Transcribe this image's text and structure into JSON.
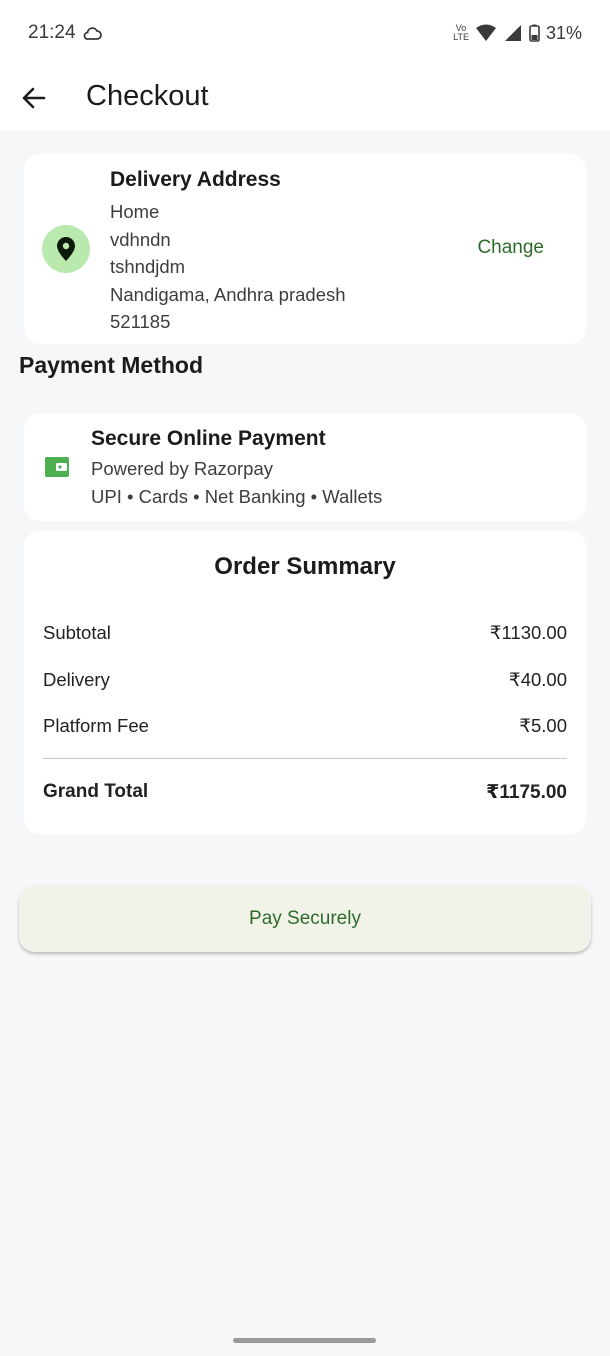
{
  "status_bar": {
    "time": "21:24",
    "battery": "31%",
    "network": "LTE"
  },
  "header": {
    "title": "Checkout"
  },
  "address": {
    "title": "Delivery Address",
    "lines": [
      "Home",
      "vdhndn",
      "tshndjdm",
      "Nandigama, Andhra pradesh",
      "521185"
    ],
    "change_label": "Change"
  },
  "payment": {
    "section_title": "Payment Method",
    "title": "Secure Online Payment",
    "subtitle": "Powered by Razorpay",
    "methods": "UPI • Cards • Net Banking • Wallets"
  },
  "summary": {
    "title": "Order Summary",
    "subtotal_label": "Subtotal",
    "subtotal_value": "₹1130.00",
    "delivery_label": "Delivery",
    "delivery_value": "₹40.00",
    "fee_label": "Platform Fee",
    "fee_value": "₹5.00",
    "total_label": "Grand Total",
    "total_value": "₹1175.00"
  },
  "pay_button_label": "Pay Securely",
  "colors": {
    "accent_green": "#2e6b2a",
    "pin_bg": "#b9e9ad",
    "wallet_green": "#4caf50",
    "button_bg": "#f1f3e8"
  }
}
